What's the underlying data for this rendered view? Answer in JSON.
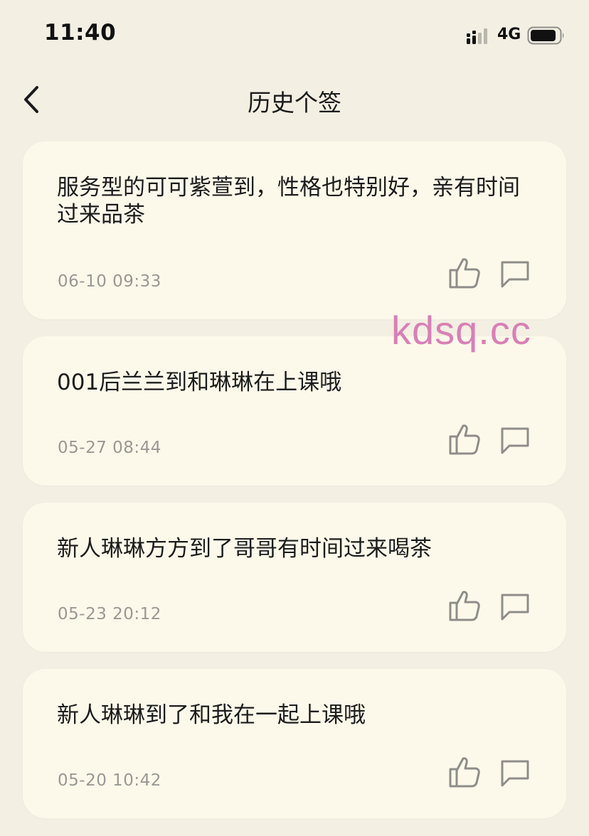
{
  "status_bar": {
    "time": "11:40",
    "network": "4G"
  },
  "nav": {
    "title": "历史个签"
  },
  "posts": [
    {
      "text": "服务型的可可紫萱到，性格也特别好，亲有时间过来品茶",
      "time": "06-10 09:33"
    },
    {
      "text": "001后兰兰到和琳琳在上课哦",
      "time": "05-27 08:44"
    },
    {
      "text": "新人琳琳方方到了哥哥有时间过来喝茶",
      "time": "05-23 20:12"
    },
    {
      "text": "新人琳琳到了和我在一起上课哦",
      "time": "05-20 10:42"
    }
  ],
  "watermark": "kdsq.cc",
  "colors": {
    "background": "#f3efe3",
    "card": "#fdf9ea",
    "icon": "#8f8d89",
    "timestamp": "#9a9894",
    "watermark": "#d97fb6"
  }
}
